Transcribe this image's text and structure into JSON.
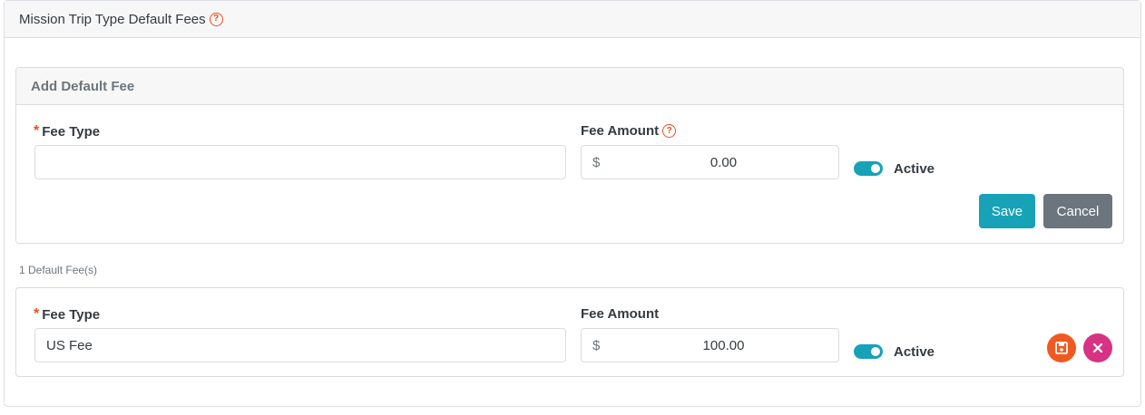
{
  "panel": {
    "title": "Mission Trip Type Default Fees"
  },
  "add_fee": {
    "header": "Add Default Fee",
    "fee_type_label": "Fee Type",
    "fee_type_value": "",
    "fee_amount_label": "Fee Amount",
    "currency_symbol": "$",
    "fee_amount_value": "0.00",
    "active_label": "Active",
    "active": true,
    "save_label": "Save",
    "cancel_label": "Cancel"
  },
  "fees_count": "1 Default Fee(s)",
  "fees": [
    {
      "fee_type_label": "Fee Type",
      "fee_type_value": "US Fee",
      "fee_amount_label": "Fee Amount",
      "currency_symbol": "$",
      "fee_amount_value": "100.00",
      "active_label": "Active",
      "active": true
    }
  ],
  "icons": {
    "help": "question-circle-icon",
    "required": "asterisk-icon",
    "save": "floppy-disk-icon",
    "delete": "x-icon"
  },
  "colors": {
    "accent": "#17a2b8",
    "required": "#e8501f",
    "save_round": "#f05a22",
    "delete_round": "#d63384",
    "cancel": "#6c757d"
  }
}
